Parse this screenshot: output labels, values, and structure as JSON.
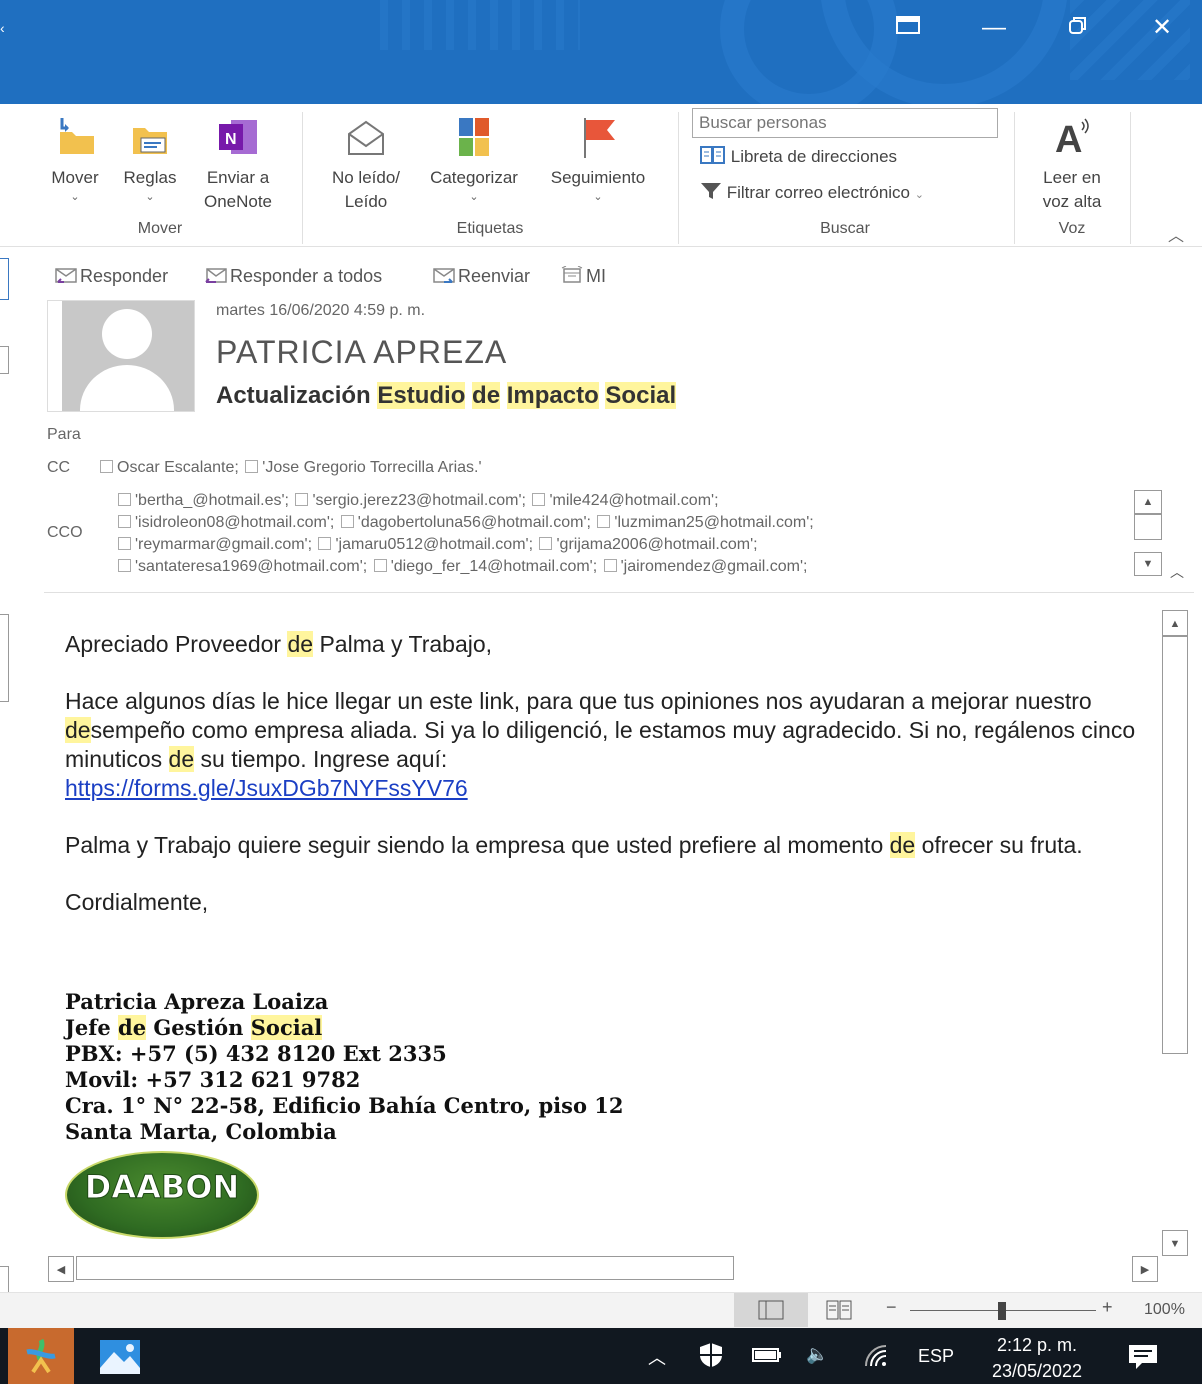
{
  "window": {
    "buttons": {
      "minimize": "—",
      "close": "✕"
    }
  },
  "ribbon": {
    "groups": {
      "mover": {
        "label": "Mover",
        "buttons": [
          {
            "label": "Mover",
            "icon": "move-folder-icon"
          },
          {
            "label": "Reglas",
            "icon": "rules-icon"
          },
          {
            "label": "Enviar a",
            "label2": "OneNote",
            "icon": "onenote-icon"
          }
        ]
      },
      "etiquetas": {
        "label": "Etiquetas",
        "buttons": [
          {
            "label": "No leído/",
            "label2": "Leído",
            "icon": "envelope-open-icon"
          },
          {
            "label": "Categorizar",
            "icon": "categorize-icon"
          },
          {
            "label": "Seguimiento",
            "icon": "flag-icon"
          }
        ]
      },
      "buscar": {
        "label": "Buscar",
        "search_placeholder": "Buscar personas",
        "address_book": "Libreta de direcciones",
        "filter_email": "Filtrar correo electrónico"
      },
      "voz": {
        "label": "Voz",
        "read_aloud": "Leer en",
        "read_aloud2": "voz alta"
      }
    }
  },
  "message": {
    "actions": [
      "Responder",
      "Responder a todos",
      "Reenviar",
      "MI"
    ],
    "date": "martes 16/06/2020 4:59 p. m.",
    "sender": "PATRICIA APREZA",
    "subject_parts": [
      {
        "text": "Actualización ",
        "hl": false
      },
      {
        "text": "Estudio",
        "hl": true
      },
      {
        "text": " ",
        "hl": false
      },
      {
        "text": "de",
        "hl": true
      },
      {
        "text": " ",
        "hl": false
      },
      {
        "text": "Impacto",
        "hl": true
      },
      {
        "text": " ",
        "hl": false
      },
      {
        "text": "Social",
        "hl": true
      }
    ],
    "para_label": "Para",
    "cc_label": "CC",
    "cc": [
      "Oscar Escalante;",
      "'Jose Gregorio Torrecilla Arias.'"
    ],
    "cco_label": "CCO",
    "cco_lines": [
      [
        "'bertha_@hotmail.es';",
        "'sergio.jerez23@hotmail.com';",
        "'mile424@hotmail.com';"
      ],
      [
        "'isidroleon08@hotmail.com';",
        "'dagobertoluna56@hotmail.com';",
        "'luzmiman25@hotmail.com';"
      ],
      [
        "'reymarmar@gmail.com';",
        "'jamaru0512@hotmail.com';",
        "'grijama2006@hotmail.com';"
      ],
      [
        "'santateresa1969@hotmail.com';",
        "'diego_fer_14@hotmail.com';",
        "'jairomendez@gmail.com';"
      ]
    ],
    "body": {
      "greeting": [
        {
          "text": "Apreciado Proveedor ",
          "hl": false
        },
        {
          "text": "de",
          "hl": true
        },
        {
          "text": " Palma y Trabajo,",
          "hl": false
        }
      ],
      "para1": [
        {
          "text": "Hace algunos días le hice llegar un este link, para que tus opiniones nos ayudaran a mejorar nuestro ",
          "hl": false
        },
        {
          "text": "de",
          "hl": true
        },
        {
          "text": "sempeño como empresa aliada.  Si ya lo diligenció, le estamos muy agradecido.  Si no, regálenos cinco minuticos ",
          "hl": false
        },
        {
          "text": "de",
          "hl": true
        },
        {
          "text": " su tiempo.  Ingrese aquí:",
          "hl": false
        }
      ],
      "link": "https://forms.gle/JsuxDGb7NYFssYV76",
      "para2": [
        {
          "text": "Palma y Trabajo quiere seguir siendo la empresa que usted prefiere al momento ",
          "hl": false
        },
        {
          "text": "de",
          "hl": true
        },
        {
          "text": " ofrecer su fruta.",
          "hl": false
        }
      ],
      "closing": "Cordialmente,"
    },
    "signature": {
      "name": "Patricia Apreza Loaiza",
      "title_parts": [
        {
          "text": "Jefe ",
          "hl": false
        },
        {
          "text": "de",
          "hl": true
        },
        {
          "text": " Gestión ",
          "hl": false
        },
        {
          "text": "Social",
          "hl": true
        }
      ],
      "pbx": "PBX: +57 (5) 432 8120  Ext 2335",
      "movil": "Movil: +57  312 621 9782",
      "address": "Cra. 1° N° 22-58, Edificio Bahía Centro, piso 12",
      "city": "Santa Marta, Colombia",
      "logo_text": "DAABON"
    }
  },
  "statusbar": {
    "zoom": "100%"
  },
  "taskbar": {
    "language": "ESP",
    "time": "2:12 p. m.",
    "date": "23/05/2022"
  },
  "colors": {
    "titlebar": "#1f6fc0",
    "highlight": "#fff59d",
    "link": "#1b3fc4",
    "taskbar": "#111820",
    "logo_green": "#2f6b22"
  }
}
